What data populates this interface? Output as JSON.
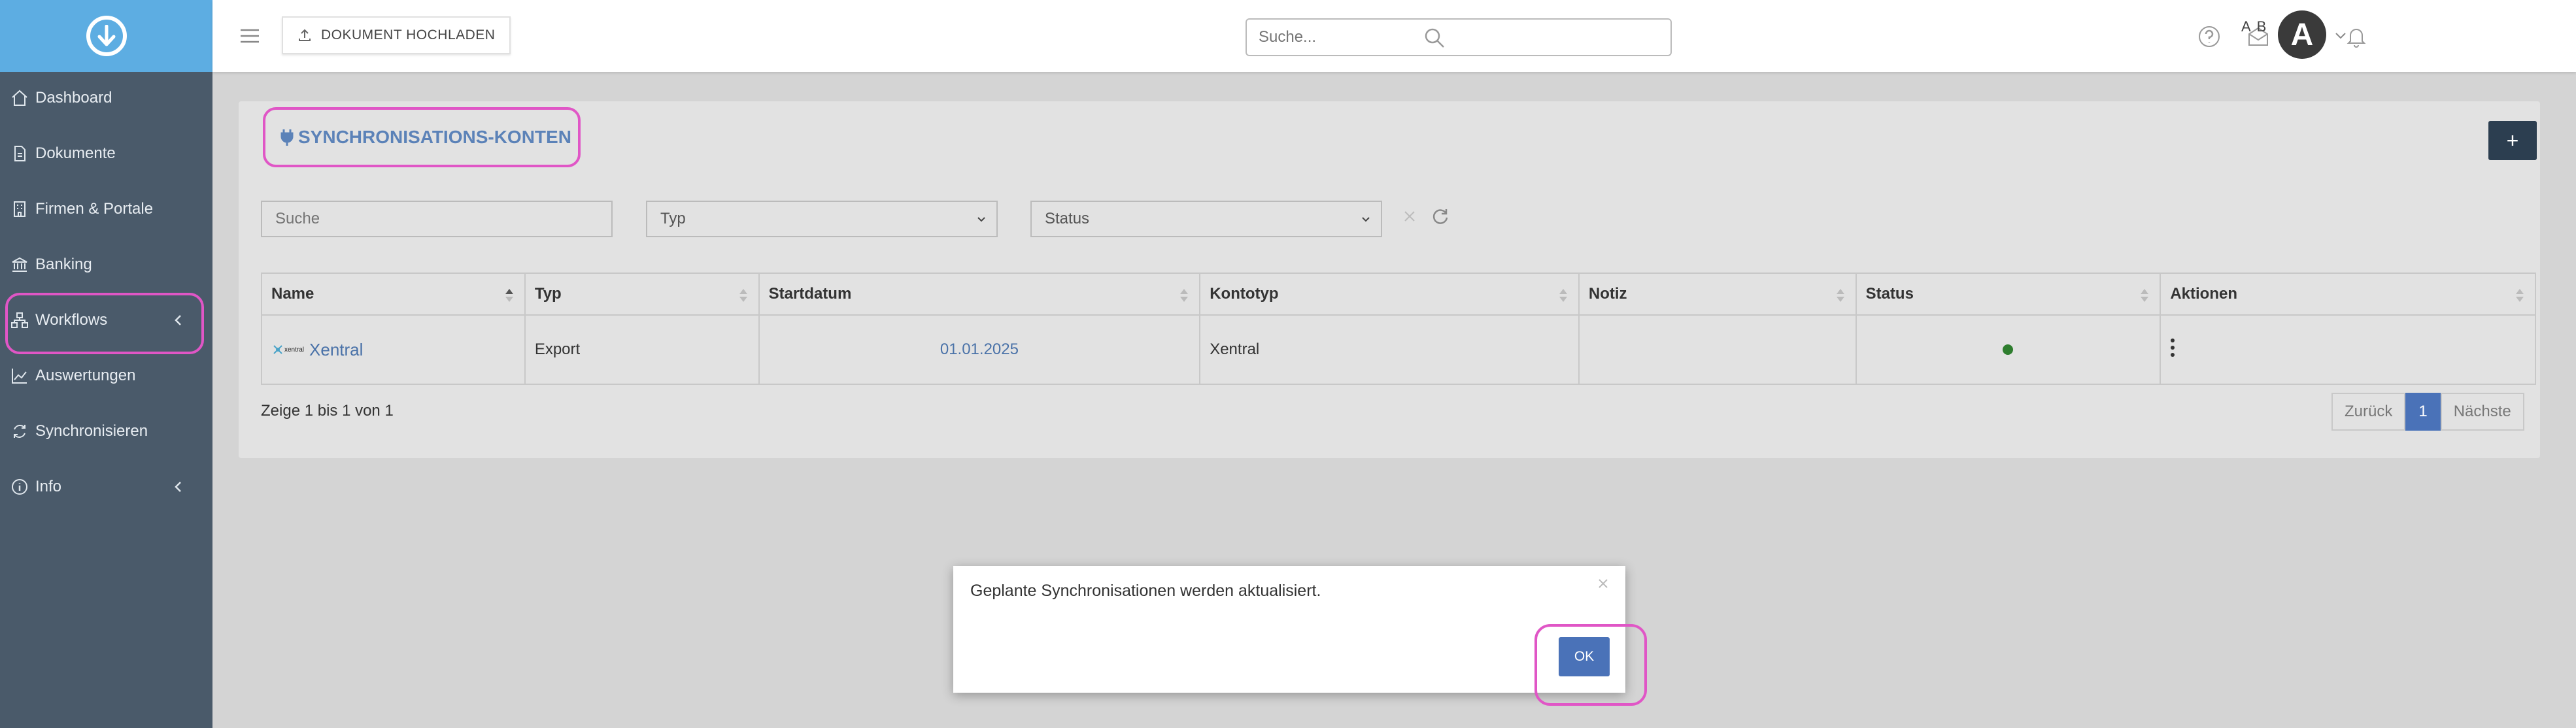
{
  "sidebar": {
    "items": [
      {
        "label": "Dashboard",
        "icon": "home-icon"
      },
      {
        "label": "Dokumente",
        "icon": "document-icon"
      },
      {
        "label": "Firmen & Portale",
        "icon": "building-icon"
      },
      {
        "label": "Banking",
        "icon": "bank-icon"
      },
      {
        "label": "Workflows",
        "icon": "workflow-icon"
      },
      {
        "label": "Auswertungen",
        "icon": "chart-icon"
      },
      {
        "label": "Synchronisieren",
        "icon": "sync-icon"
      },
      {
        "label": "Info",
        "icon": "info-icon"
      }
    ]
  },
  "topbar": {
    "upload_label": "DOKUMENT HOCHLADEN",
    "search_placeholder": "Suche...",
    "user_initials": "A B",
    "avatar_letter": "A"
  },
  "card": {
    "title": "SYNCHRONISATIONS-KONTEN",
    "add_label": "+",
    "filters": {
      "search_placeholder": "Suche",
      "type_placeholder": "Typ",
      "status_placeholder": "Status"
    },
    "columns": [
      "Name",
      "Typ",
      "Startdatum",
      "Kontotyp",
      "Notiz",
      "Status",
      "Aktionen"
    ],
    "rows": [
      {
        "logo_text": "xentral",
        "name": "Xentral",
        "type": "Export",
        "start_date": "01.01.2025",
        "account_type": "Xentral",
        "note": "",
        "status": "active"
      }
    ],
    "info": "Zeige 1 bis 1 von 1",
    "pager": {
      "prev": "Zurück",
      "current": "1",
      "next": "Nächste"
    }
  },
  "modal": {
    "message": "Geplante Synchronisationen werden aktualisiert.",
    "ok_label": "OK"
  },
  "colors": {
    "sidebar_bg": "#4a5a6a",
    "logo_bg": "#5dade2",
    "accent": "#4a72b8",
    "highlight": "#e056c6",
    "status_active": "#2e7d2e"
  }
}
